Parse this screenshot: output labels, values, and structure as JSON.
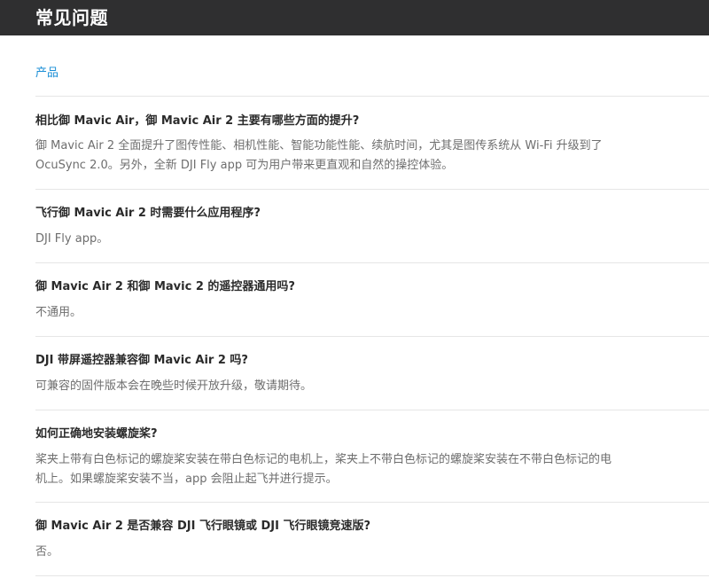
{
  "header": {
    "title": "常见问题"
  },
  "category": {
    "label": "产品"
  },
  "faq": [
    {
      "question": "相比御 Mavic Air，御 Mavic Air 2 主要有哪些方面的提升?",
      "answer_lines": [
        "御 Mavic Air 2 全面提升了图传性能、相机性能、智能功能性能、续航时间，尤其是图传系统从 Wi-Fi 升级到了",
        "OcuSync 2.0。另外，全新 DJI Fly app 可为用户带来更直观和自然的操控体验。"
      ]
    },
    {
      "question": "飞行御 Mavic Air 2 时需要什么应用程序?",
      "answer_lines": [
        "DJI Fly app。"
      ]
    },
    {
      "question": "御 Mavic Air 2 和御 Mavic 2 的遥控器通用吗?",
      "answer_lines": [
        "不通用。"
      ]
    },
    {
      "question": "DJI 带屏遥控器兼容御 Mavic Air 2 吗?",
      "answer_lines": [
        "可兼容的固件版本会在晚些时候开放升级，敬请期待。"
      ]
    },
    {
      "question": "如何正确地安装螺旋桨?",
      "answer_lines": [
        "桨夹上带有白色标记的螺旋桨安装在带白色标记的电机上，桨夹上不带白色标记的螺旋桨安装在不带白色标记的电",
        "机上。如果螺旋桨安装不当，app 会阻止起飞并进行提示。"
      ]
    },
    {
      "question": "御 Mavic Air 2 是否兼容 DJI 飞行眼镜或 DJI 飞行眼镜竞速版?",
      "answer_lines": [
        "否。"
      ]
    }
  ]
}
